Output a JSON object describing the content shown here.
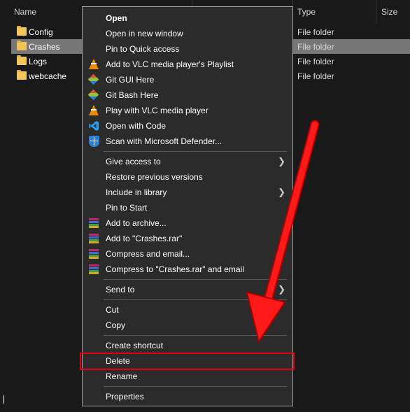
{
  "columns": {
    "name": "Name",
    "type": "Type",
    "size": "Size"
  },
  "files": [
    {
      "name": "Config",
      "type": "File folder",
      "selected": false
    },
    {
      "name": "Crashes",
      "type": "File folder",
      "selected": true
    },
    {
      "name": "Logs",
      "type": "File folder",
      "selected": false
    },
    {
      "name": "webcache",
      "type": "File folder",
      "selected": false
    }
  ],
  "menu": {
    "open": "Open",
    "open_new_window": "Open in new window",
    "pin_quick_access": "Pin to Quick access",
    "vlc_add_playlist": "Add to VLC media player's Playlist",
    "git_gui": "Git GUI Here",
    "git_bash": "Git Bash Here",
    "vlc_play": "Play with VLC media player",
    "open_code": "Open with Code",
    "defender_scan": "Scan with Microsoft Defender...",
    "give_access": "Give access to",
    "restore_versions": "Restore previous versions",
    "include_library": "Include in library",
    "pin_start": "Pin to Start",
    "add_archive": "Add to archive...",
    "add_rar": "Add to \"Crashes.rar\"",
    "compress_email": "Compress and email...",
    "compress_rar_email": "Compress to \"Crashes.rar\" and email",
    "send_to": "Send to",
    "cut": "Cut",
    "copy": "Copy",
    "create_shortcut": "Create shortcut",
    "delete": "Delete",
    "rename": "Rename",
    "properties": "Properties"
  },
  "icons": {
    "vlc": "vlc-cone-icon",
    "git": "git-icon",
    "vscode": "vscode-icon",
    "defender": "defender-shield-icon",
    "winrar": "winrar-icon",
    "submenu": "chevron-right-icon"
  },
  "colors": {
    "highlight_box": "#e0000f",
    "annotation_arrow": "#ff1a1a",
    "menu_bg": "#2b2b2b",
    "selected_row": "#777777"
  }
}
